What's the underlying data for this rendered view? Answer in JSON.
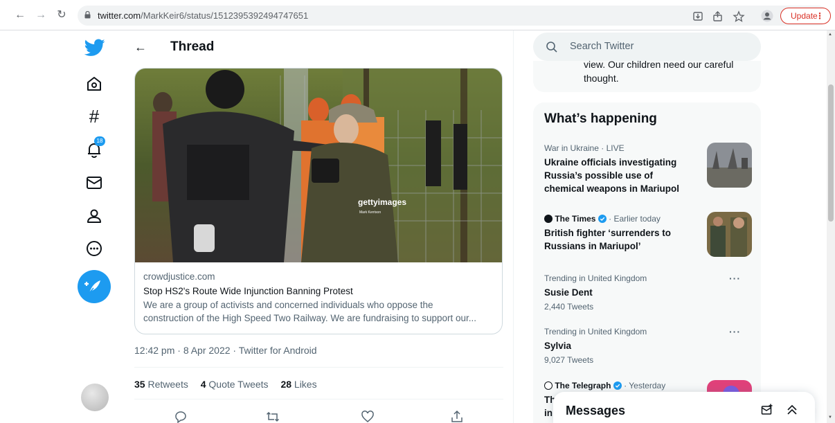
{
  "browser": {
    "url_host": "twitter.com",
    "url_path": "/MarkKeir6/status/1512395392494747651",
    "update_label": "Update"
  },
  "nav": {
    "notifications_badge": "18"
  },
  "thread": {
    "title": "Thread",
    "card": {
      "watermark": "gettyimages",
      "watermark_credit": "Mark Kerrison",
      "domain": "crowdjustice.com",
      "title": "Stop HS2's Route Wide Injunction Banning Protest",
      "description_line1": "We are a group of activists and concerned individuals who oppose the",
      "description_line2": "construction of the High Speed Two Railway. We are fundraising to support our..."
    },
    "timestamp": "12:42 pm · 8 Apr 2022 · Twitter for Android",
    "stats": {
      "retweets_count": "35",
      "retweets_label": "Retweets",
      "quotes_count": "4",
      "quotes_label": "Quote Tweets",
      "likes_count": "28",
      "likes_label": "Likes"
    }
  },
  "sidebar": {
    "search_placeholder": "Search Twitter",
    "previous_text_line1": "view. Our children need our careful",
    "previous_text_line2": "thought.",
    "happening_title": "What’s happening",
    "trends": [
      {
        "meta": "War in Ukraine · LIVE",
        "title": "Ukraine officials investigating Russia’s possible use of chemical weapons in Mariupol"
      },
      {
        "publisher": "The Times",
        "meta": "· Earlier today",
        "title": "British fighter ‘surrenders to Russians in Mariupol’"
      },
      {
        "meta": "Trending in United Kingdom",
        "title": "Susie Dent",
        "count": "2,440 Tweets"
      },
      {
        "meta": "Trending in United Kingdom",
        "title": "Sylvia",
        "count": "9,027 Tweets"
      },
      {
        "publisher": "The Telegraph",
        "meta": "· Yesterday",
        "title_fragment_1": "Th",
        "title_fragment_2": "in"
      }
    ],
    "messages_title": "Messages"
  },
  "colors": {
    "accent": "#1d9bf0",
    "update_red": "#d93025",
    "sidebar_bg": "#f7f9f9"
  }
}
